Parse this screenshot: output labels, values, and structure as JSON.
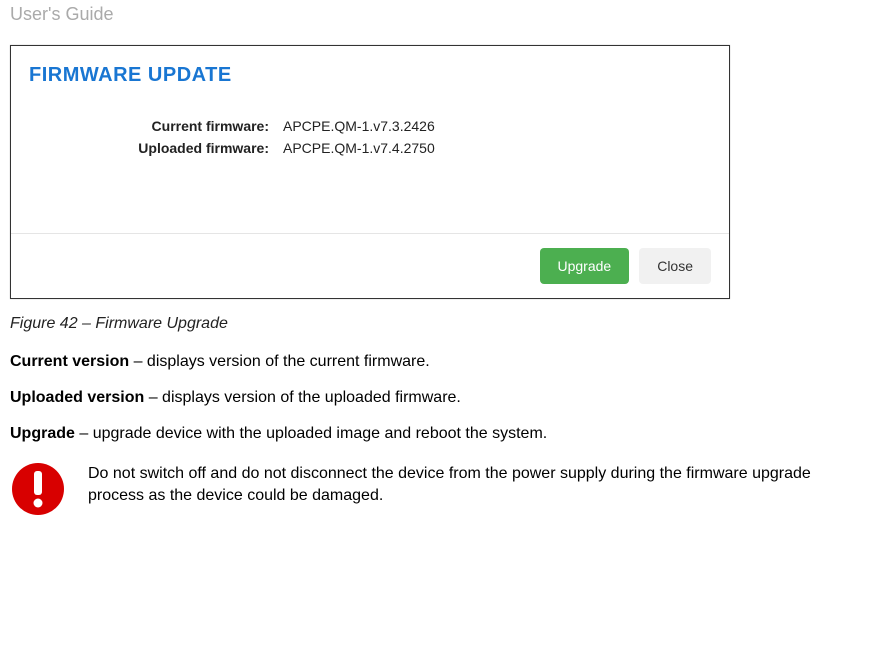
{
  "header": {
    "title": "User's Guide"
  },
  "dialog": {
    "title": "FIRMWARE UPDATE",
    "rows": {
      "current": {
        "label": "Current firmware:",
        "value": "APCPE.QM-1.v7.3.2426"
      },
      "uploaded": {
        "label": "Uploaded firmware:",
        "value": "APCPE.QM-1.v7.4.2750"
      }
    },
    "buttons": {
      "upgrade": "Upgrade",
      "close": "Close"
    }
  },
  "figure_caption": "Figure 42 – Firmware Upgrade",
  "descriptions": {
    "current": {
      "term": "Current version",
      "text": " – displays version of the current firmware."
    },
    "uploaded": {
      "term": "Uploaded version",
      "text": " – displays version of the uploaded firmware."
    },
    "upgrade": {
      "term": "Upgrade",
      "text": " – upgrade device with the uploaded image and reboot the system."
    }
  },
  "warning": {
    "text": "Do not switch off and do not disconnect the device from the power supply during the firmware upgrade process as the device could be damaged."
  }
}
